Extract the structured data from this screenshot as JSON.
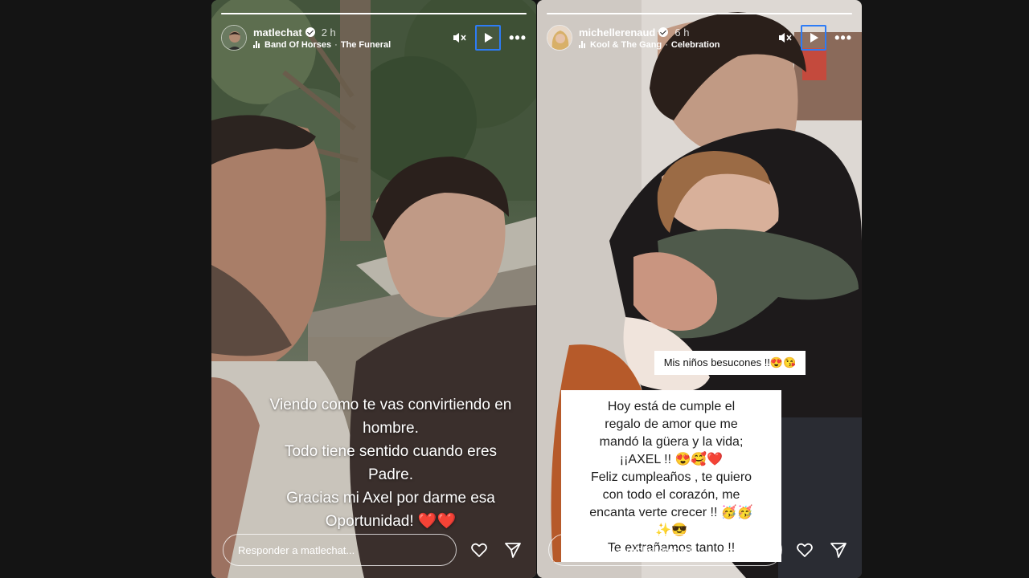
{
  "stories": {
    "left": {
      "progress": 1.0,
      "username": "matlechat",
      "time": "2 h",
      "music": {
        "artist": "Band Of Horses",
        "track": "The Funeral"
      },
      "caption": [
        "Viendo como te vas convirtiendo en",
        "hombre.",
        "Todo tiene sentido  cuando eres",
        "Padre.",
        "Gracias mi Axel por darme esa",
        "Oportunidad! ❤️❤️"
      ],
      "reply_placeholder": "Responder a matlechat..."
    },
    "right": {
      "progress": 1.0,
      "username": "michellerenaud",
      "time": "6 h",
      "music": {
        "artist": "Kool & The Gang",
        "track": "Celebration"
      },
      "sticker_small": "Mis niños besucones !!😍😘",
      "sticker_big": [
        "Hoy está de cumple el",
        "regalo de amor que me",
        "mandó la güera y la vida;",
        "¡¡AXEL !! 😍🥰❤️",
        "Feliz cumpleaños , te quiero",
        "con todo el corazón, me",
        "encanta verte crecer !! 🥳🥳",
        "✨😎",
        "Te extrañamos tanto !!"
      ],
      "reply_placeholder": "Responder a michellerenaud..."
    }
  },
  "icons": {
    "verified": "verified-badge-icon",
    "music": "music-bars-icon",
    "mute": "speaker-muted-icon",
    "play": "play-icon",
    "more": "more-options-icon",
    "like": "heart-icon",
    "share": "paper-plane-icon"
  },
  "colors": {
    "accent_focus": "#2d7cf6",
    "background": "#141414"
  }
}
